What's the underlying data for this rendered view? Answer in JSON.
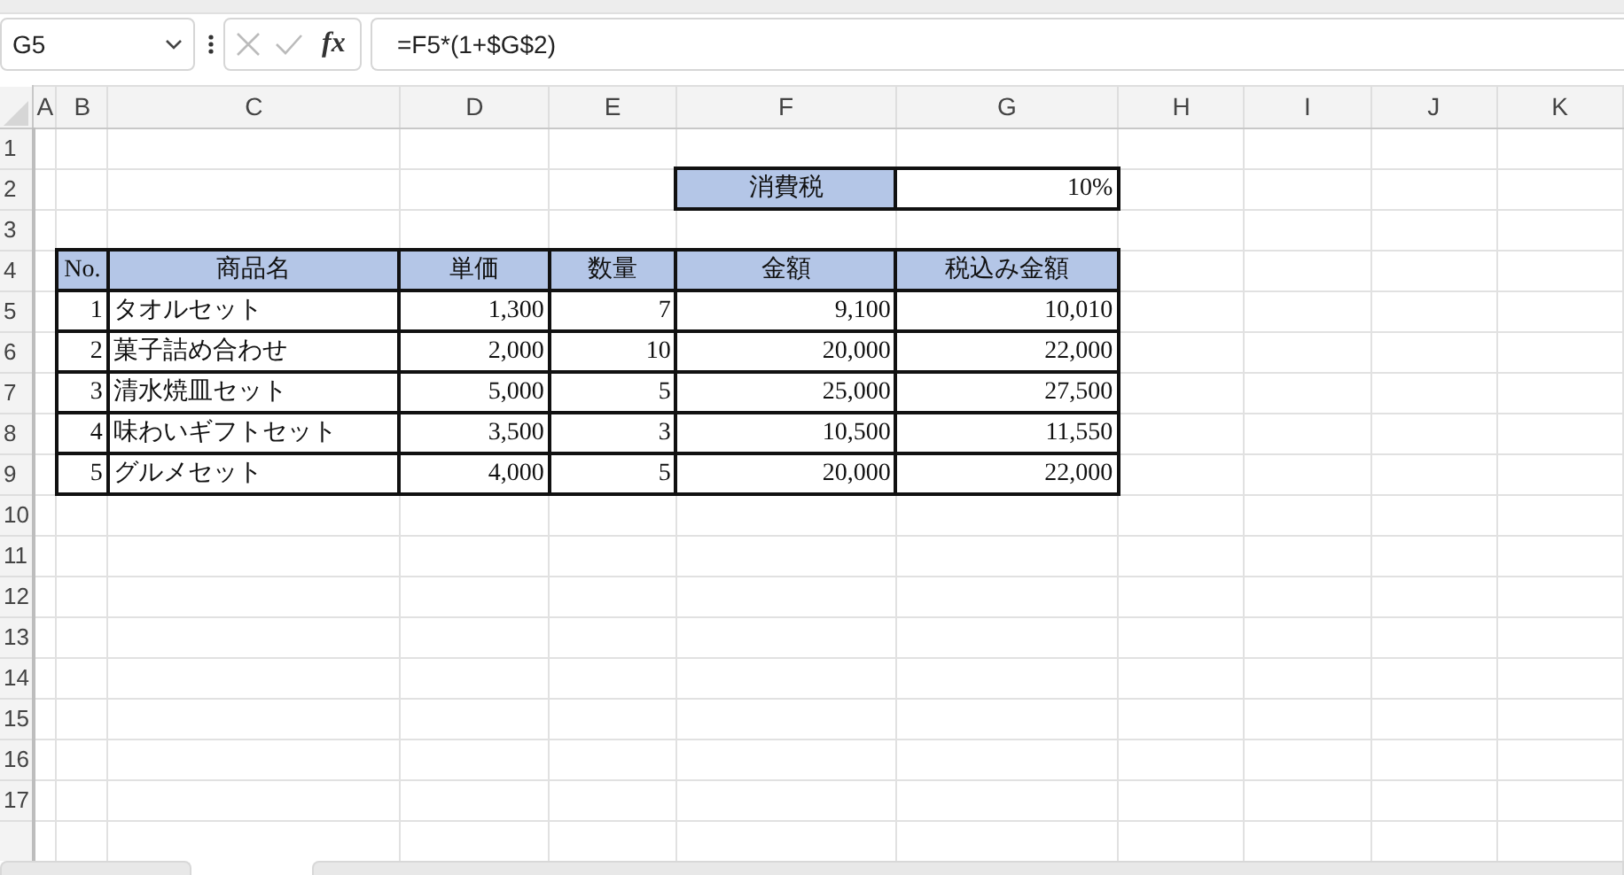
{
  "name_box": "G5",
  "formula_bar": {
    "function_label": "fx",
    "formula": "=F5*(1+$G$2)"
  },
  "columns": [
    "A",
    "B",
    "C",
    "D",
    "E",
    "F",
    "G",
    "H",
    "I",
    "J",
    "K"
  ],
  "rows": [
    "1",
    "2",
    "3",
    "4",
    "5",
    "6",
    "7",
    "8",
    "9",
    "10",
    "11",
    "12",
    "13",
    "14",
    "15",
    "16",
    "17"
  ],
  "tax": {
    "label": "消費税",
    "value": "10%"
  },
  "table": {
    "columns": [
      "No.",
      "商品名",
      "単価",
      "数量",
      "金額",
      "税込み金額"
    ],
    "rows": [
      [
        "1",
        "タオルセット",
        "1,300",
        "7",
        "9,100",
        "10,010"
      ],
      [
        "2",
        "菓子詰め合わせ",
        "2,000",
        "10",
        "20,000",
        "22,000"
      ],
      [
        "3",
        "清水焼皿セット",
        "5,000",
        "5",
        "25,000",
        "27,500"
      ],
      [
        "4",
        "味わいギフトセット",
        "3,500",
        "3",
        "10,500",
        "11,550"
      ],
      [
        "5",
        "グルメセット",
        "4,000",
        "5",
        "20,000",
        "22,000"
      ]
    ]
  }
}
